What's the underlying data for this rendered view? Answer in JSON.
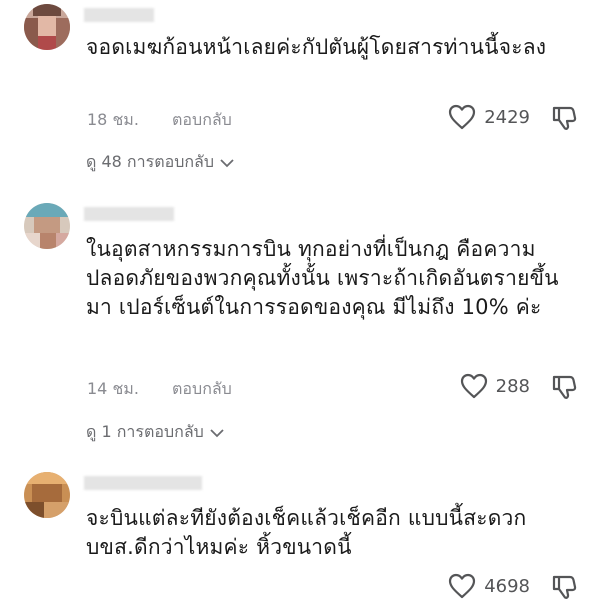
{
  "comments": [
    {
      "text": "จอดเมฆก้อนหน้าเลยค่ะกัปตันผู้โดยสารท่านนี้จะลง",
      "time": "18 ชม.",
      "reply_label": "ตอบกลับ",
      "likes": "2429",
      "view_replies": "ดู 48 การตอบกลับ"
    },
    {
      "text": "ในอุตสาหกรรมการบิน ทุกอย่างที่เป็นกฎ คือความปลอดภัยของพวกคุณทั้งนั้น เพราะถ้าเกิดอันตรายขึ้นมา เปอร์เซ็นต์ในการรอดของคุณ มีไม่ถึง 10% ค่ะ",
      "time": "14 ชม.",
      "reply_label": "ตอบกลับ",
      "likes": "288",
      "view_replies": "ดู 1 การตอบกลับ"
    },
    {
      "text": "จะบินแต่ละทียังต้องเช็คแล้วเช็คอีก แบบนี้สะดวกบขส.ดีกว่าไหมค่ะ หิ้วขนาดนี้",
      "likes": "4698"
    }
  ],
  "icons": {
    "like": "heart-outline-icon",
    "dislike": "thumbs-down-outline-icon",
    "expand": "chevron-down-icon"
  }
}
